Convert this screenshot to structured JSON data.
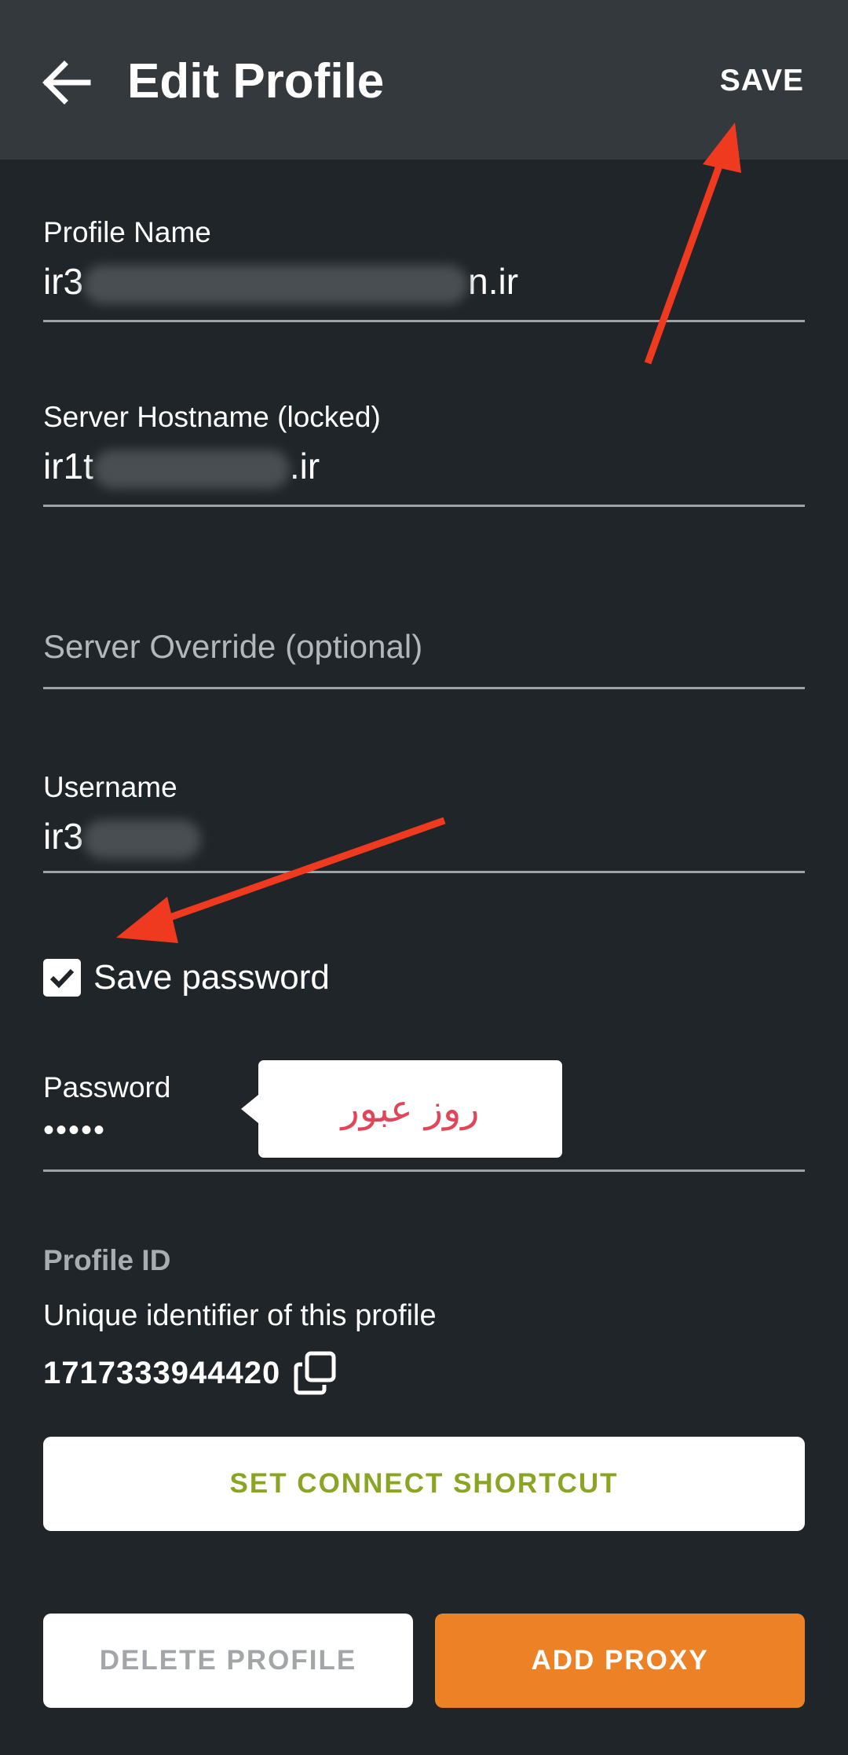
{
  "header": {
    "title": "Edit Profile",
    "save_label": "SAVE",
    "back_icon": "arrow-left-icon"
  },
  "fields": {
    "profile_name": {
      "label": "Profile Name",
      "value_prefix": "ir3",
      "value_suffix": "n.ir"
    },
    "server_hostname": {
      "label": "Server Hostname (locked)",
      "value_prefix": "ir1t",
      "value_suffix": ".ir"
    },
    "server_override": {
      "placeholder": "Server Override (optional)"
    },
    "username": {
      "label": "Username",
      "value_prefix": "ir3"
    },
    "password": {
      "label": "Password",
      "value": "•••••"
    }
  },
  "save_password": {
    "label": "Save password",
    "checked": true
  },
  "tooltip": {
    "text": "روز عبور"
  },
  "profile_id": {
    "title": "Profile ID",
    "description": "Unique identifier of this profile",
    "value": "1717333944420",
    "copy_icon": "copy-icon"
  },
  "buttons": {
    "set_connect_shortcut": "SET CONNECT SHORTCUT",
    "delete_profile": "DELETE PROFILE",
    "add_proxy": "ADD PROXY"
  },
  "colors": {
    "background": "#1f2528",
    "appbar": "#33393c",
    "accent_orange": "#ec8126",
    "shortcut_green": "#8aa424",
    "annotation_red": "#f03a1f"
  }
}
